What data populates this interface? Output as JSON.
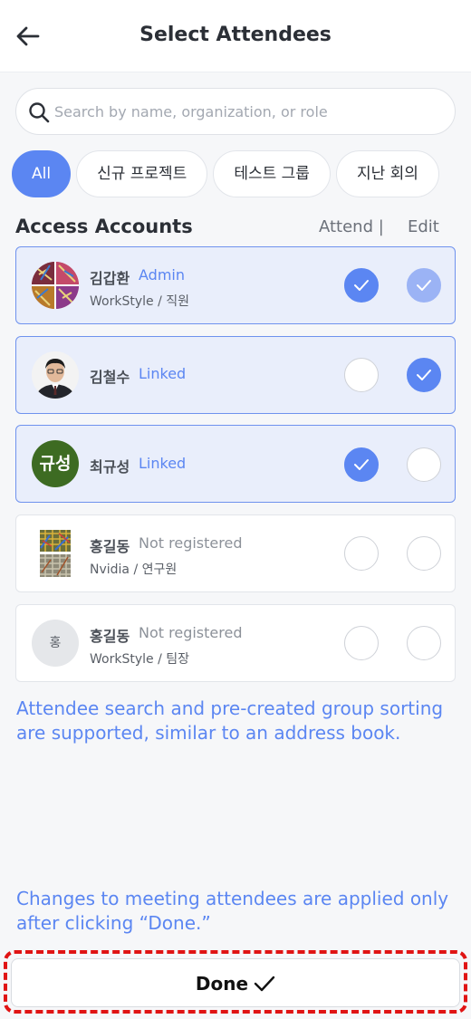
{
  "header": {
    "title": "Select Attendees",
    "back_icon": "arrow-left-icon"
  },
  "search": {
    "placeholder": "Search by name, organization, or role",
    "value": ""
  },
  "filters": [
    {
      "label": "All",
      "active": true
    },
    {
      "label": "신규 프로젝트",
      "active": false
    },
    {
      "label": "테스트 그룹",
      "active": false
    },
    {
      "label": "지난 회의",
      "active": false
    }
  ],
  "section": {
    "title": "Access Accounts",
    "attend_label": "Attend |",
    "edit_label": "Edit"
  },
  "attendees": [
    {
      "name": "김갑환",
      "role": "Admin",
      "org": "WorkStyle / 직원",
      "attend": true,
      "edit": true,
      "avatar": "pattern-image"
    },
    {
      "name": "김철수",
      "role": "Linked",
      "org": "",
      "attend": false,
      "edit": true,
      "avatar": "photo"
    },
    {
      "name": "최규성",
      "role": "Linked",
      "org": "",
      "attend": true,
      "edit": false,
      "avatar_text": "규성"
    },
    {
      "name": "홍길동",
      "role": "Not registered",
      "org": "Nvidia / 연구원",
      "attend": false,
      "edit": false,
      "avatar": "pattern-image"
    },
    {
      "name": "홍길동",
      "role": "Not registered",
      "org": "WorkStyle / 팀장",
      "attend": false,
      "edit": false,
      "avatar_text": "홍"
    }
  ],
  "notes": {
    "search_note": "Attendee search and pre-created group sorting are supported, similar to an address book.",
    "done_note": "Changes to meeting attendees are applied only after clicking “Done.”"
  },
  "done_button": {
    "label": "Done",
    "icon": "checkmark-icon"
  },
  "colors": {
    "accent": "#5b86f2",
    "selected_bg": "#e9eefb",
    "highlight": "#e01414"
  }
}
